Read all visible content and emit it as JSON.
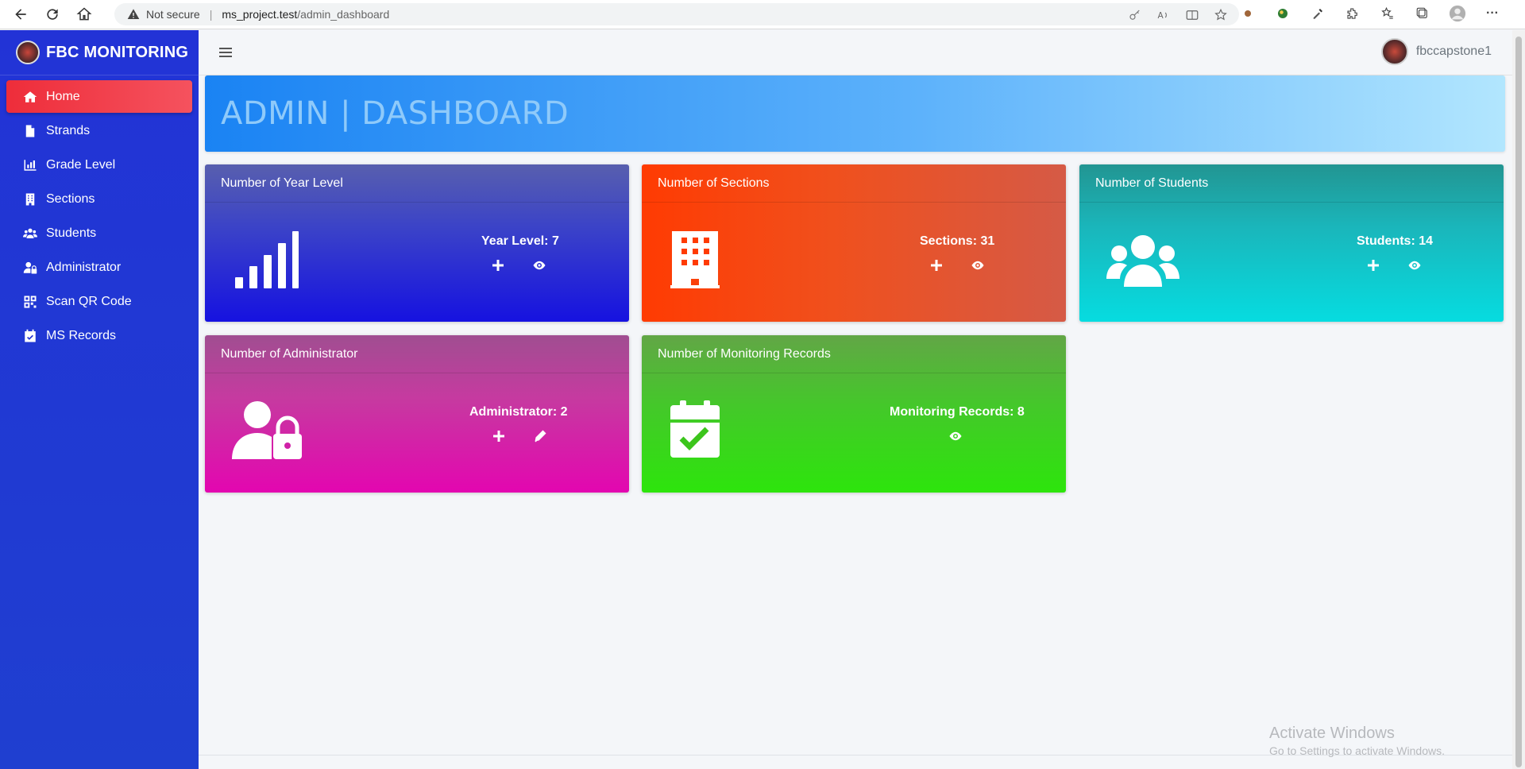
{
  "browser": {
    "security_label": "Not secure",
    "url_host": "ms_project.test",
    "url_path": "/admin_dashboard"
  },
  "sidebar": {
    "brand": "FBC MONITORING",
    "items": [
      {
        "label": "Home",
        "icon": "home-icon",
        "active": true
      },
      {
        "label": "Strands",
        "icon": "file-icon"
      },
      {
        "label": "Grade Level",
        "icon": "bar-chart-icon"
      },
      {
        "label": "Sections",
        "icon": "building-icon"
      },
      {
        "label": "Students",
        "icon": "users-icon"
      },
      {
        "label": "Administrator",
        "icon": "user-lock-icon"
      },
      {
        "label": "Scan QR Code",
        "icon": "qr-code-icon"
      },
      {
        "label": "MS Records",
        "icon": "calendar-check-icon"
      }
    ]
  },
  "topbar": {
    "username": "fbccapstone1"
  },
  "header": {
    "title": "ADMIN | DASHBOARD"
  },
  "cards": [
    {
      "title": "Number of Year Level",
      "stat": "Year Level: 7",
      "icon": "signal-icon",
      "actions": [
        "plus-icon",
        "eye-icon"
      ]
    },
    {
      "title": "Number of Sections",
      "stat": "Sections: 31",
      "icon": "building-icon",
      "actions": [
        "plus-icon",
        "eye-icon"
      ]
    },
    {
      "title": "Number of Students",
      "stat": "Students: 14",
      "icon": "users-icon",
      "actions": [
        "plus-icon",
        "eye-icon"
      ]
    },
    {
      "title": "Number of Administrator",
      "stat": "Administrator: 2",
      "icon": "user-lock-icon",
      "actions": [
        "plus-icon",
        "edit-icon"
      ]
    },
    {
      "title": "Number of Monitoring Records",
      "stat": "Monitoring Records: 8",
      "icon": "calendar-check-icon",
      "actions": [
        "eye-icon"
      ]
    }
  ],
  "watermark": {
    "line1": "Activate Windows",
    "line2": "Go to Settings to activate Windows."
  },
  "colors": {
    "sidebar": "#2233d6",
    "active_item": "#ee2d3a",
    "card_year_level": "#1612e0",
    "card_sections": "#ff3b02",
    "card_students": "#06dce0",
    "card_administrator": "#e306b0",
    "card_records": "#2de50c"
  }
}
